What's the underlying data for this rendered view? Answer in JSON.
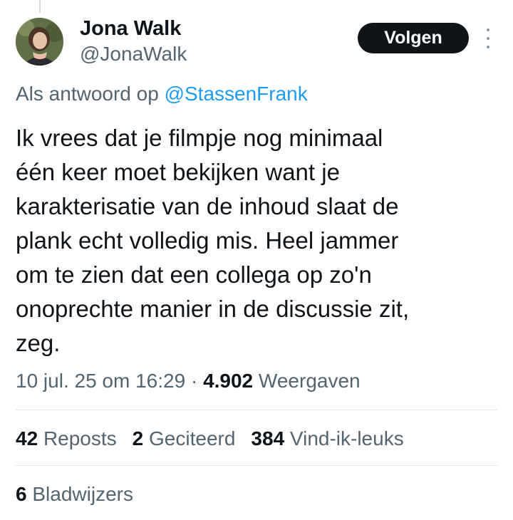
{
  "author": {
    "name": "Jona Walk",
    "handle": "@JonaWalk"
  },
  "follow_label": "Volgen",
  "reply": {
    "prefix": "Als antwoord op",
    "handle": "@StassenFrank"
  },
  "tweet": {
    "lines": [
      "Ik vrees dat je filmpje nog minimaal",
      "één keer moet bekijken want je",
      "karakterisatie van de inhoud slaat de",
      "plank echt volledig mis. Heel jammer",
      "om te zien dat een collega op zo'n",
      "onoprechte manier in de discussie zit,",
      "zeg."
    ]
  },
  "meta": {
    "timestamp": "10 jul. 25 om 16:29",
    "separator": "·",
    "views_count": "4.902",
    "views_label": "Weergaven"
  },
  "stats": {
    "reposts_count": "42",
    "reposts_label": "Reposts",
    "quotes_count": "2",
    "quotes_label": "Geciteerd",
    "likes_count": "384",
    "likes_label": "Vind-ik-leuks",
    "bookmarks_count": "6",
    "bookmarks_label": "Bladwijzers"
  },
  "icons": {
    "more": "more-vertical-icon"
  },
  "colors": {
    "text": "#0f1419",
    "secondary": "#536471",
    "link": "#1d9bf0",
    "button_bg": "#0f1419",
    "divider": "#e1e8ed"
  }
}
